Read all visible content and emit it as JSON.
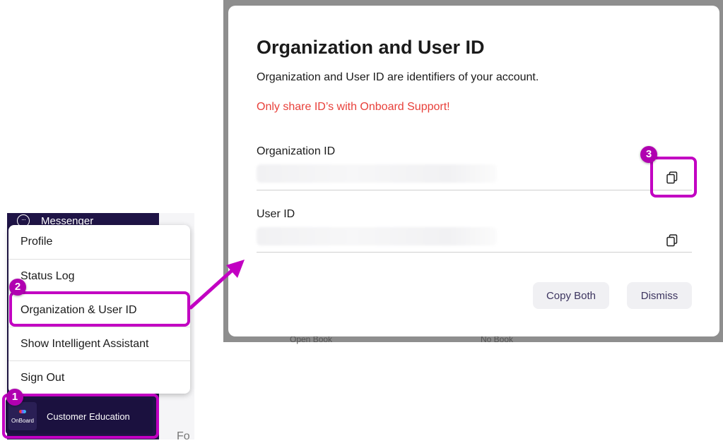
{
  "sidebar": {
    "messenger_label": "Messenger",
    "messenger_icon": "chat-bubble-icon",
    "partial_text": "Fo",
    "profile": {
      "logo_text": "OnBoard",
      "name": "Customer Education"
    }
  },
  "menu": {
    "items": [
      {
        "label": "Profile"
      },
      {
        "label": "Status Log"
      },
      {
        "label": "Organization & User ID"
      },
      {
        "label": "Show Intelligent Assistant"
      },
      {
        "label": "Sign Out"
      }
    ]
  },
  "backdrop": {
    "left_text": "Open Book",
    "right_text": "No Book"
  },
  "modal": {
    "title": "Organization and User ID",
    "description": "Organization and User ID are identifiers of your account.",
    "warning": "Only share ID’s with Onboard Support!",
    "fields": [
      {
        "label": "Organization ID",
        "value": "",
        "icon": "copy-icon"
      },
      {
        "label": "User ID",
        "value": "",
        "icon": "copy-icon"
      }
    ],
    "buttons": {
      "copy_both": "Copy Both",
      "dismiss": "Dismiss"
    }
  },
  "annotations": {
    "step1": "1",
    "step2": "2",
    "step3": "3",
    "highlight_color": "#c200c2"
  },
  "colors": {
    "sidebar_bg": "#1f1446",
    "warning": "#e8403a",
    "button_text": "#3d3560"
  }
}
